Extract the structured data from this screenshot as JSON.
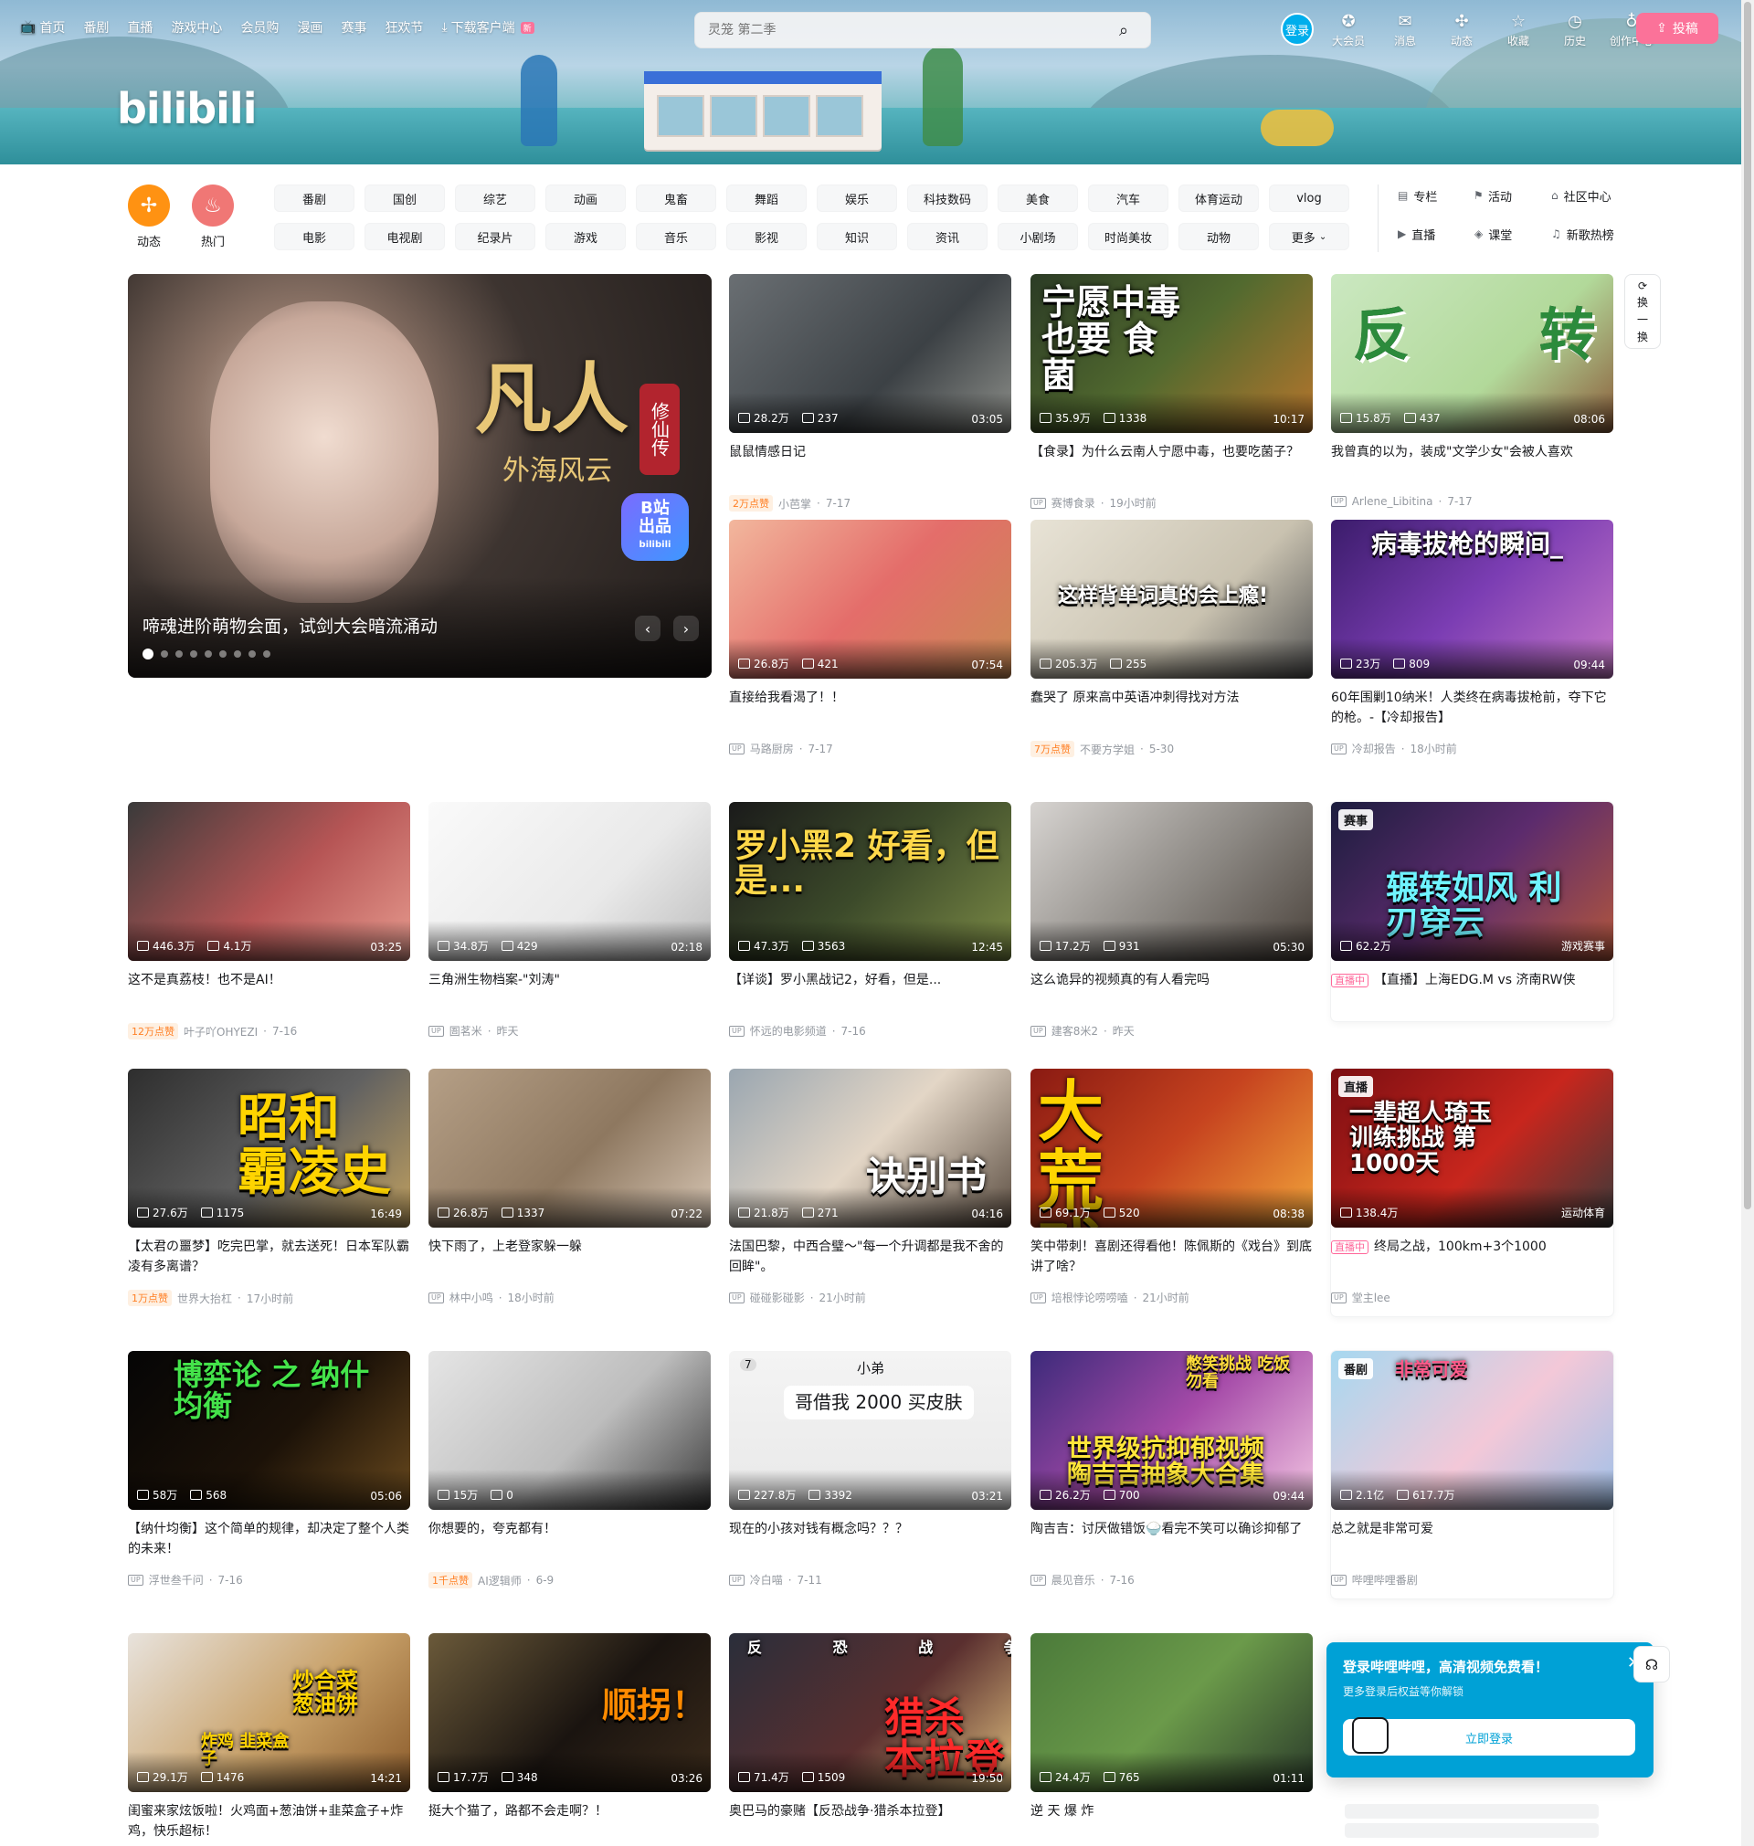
{
  "topnav": [
    {
      "icon": "tv-icon",
      "label": "首页"
    },
    {
      "label": "番剧"
    },
    {
      "label": "直播"
    },
    {
      "label": "游戏中心"
    },
    {
      "label": "会员购"
    },
    {
      "label": "漫画"
    },
    {
      "label": "赛事"
    },
    {
      "label": "狂欢节"
    },
    {
      "icon": "download-icon",
      "label": "下载客户端",
      "badge": "新"
    }
  ],
  "logo": "bilibili",
  "search": {
    "placeholder": "灵笼 第二季"
  },
  "user": {
    "login": "登录",
    "items": [
      {
        "icon": "vip-icon",
        "label": "大会员"
      },
      {
        "icon": "message-icon",
        "label": "消息"
      },
      {
        "icon": "dynamic-icon",
        "label": "动态"
      },
      {
        "icon": "star-icon",
        "label": "收藏"
      },
      {
        "icon": "history-icon",
        "label": "历史"
      },
      {
        "icon": "bulb-icon",
        "label": "创作中心"
      }
    ],
    "upload": "投稿"
  },
  "channels": {
    "big": [
      {
        "label": "动态",
        "color": "#ff9212"
      },
      {
        "label": "热门",
        "color": "#f07775"
      }
    ],
    "row1": [
      "番剧",
      "国创",
      "综艺",
      "动画",
      "鬼畜",
      "舞蹈",
      "娱乐",
      "科技数码",
      "美食",
      "汽车",
      "体育运动",
      "vlog"
    ],
    "row2": [
      "电影",
      "电视剧",
      "纪录片",
      "游戏",
      "音乐",
      "影视",
      "知识",
      "资讯",
      "小剧场",
      "时尚美妆",
      "动物",
      "更多"
    ],
    "side": [
      {
        "icon": "column-icon",
        "label": "专栏"
      },
      {
        "icon": "flag-icon",
        "label": "活动"
      },
      {
        "icon": "community-icon",
        "label": "社区中心"
      },
      {
        "icon": "live-icon",
        "label": "直播"
      },
      {
        "icon": "class-icon",
        "label": "课堂"
      },
      {
        "icon": "music-icon",
        "label": "新歌热榜"
      }
    ]
  },
  "hero": {
    "title": "凡人",
    "subtitle": "外海风云",
    "vertical": "修仙传",
    "badge1": "B站",
    "badge2": "出品",
    "badge3": "bilibili",
    "caption": "啼魂进阶萌物会面，试剑大会暗流涌动"
  },
  "refresh": {
    "label1": "换",
    "label2": "一",
    "label3": "换"
  },
  "videos": [
    {
      "views": "28.2万",
      "danmaku": "237",
      "duration": "03:05",
      "title": "鼠鼠情感日记",
      "like": "2万点赞",
      "up": "小芭掌",
      "date": "7-17"
    },
    {
      "views": "35.9万",
      "danmaku": "1338",
      "duration": "10:17",
      "title": "【食录】为什么云南人宁愿中毒，也要吃菌子？",
      "up": "赛博食录",
      "date": "19小时前",
      "overlay": "宁愿中毒 也要 食菌"
    },
    {
      "views": "15.8万",
      "danmaku": "437",
      "duration": "08:06",
      "title": "我曾真的以为，装成\"文学少女\"会被人喜欢",
      "up": "Arlene_Libitina",
      "date": "7-17",
      "overlay": "反 转"
    },
    {
      "views": "26.8万",
      "danmaku": "421",
      "duration": "07:54",
      "title": "直接给我看渴了！！",
      "up": "马路厨房",
      "date": "7-17"
    },
    {
      "views": "205.3万",
      "danmaku": "255",
      "duration": "",
      "title": "蠢哭了 原来高中英语冲刺得找对方法",
      "like": "7万点赞",
      "up": "不要方学姐",
      "date": "5-30",
      "overlay": "这样背单词真的会上瘾!"
    },
    {
      "views": "23万",
      "danmaku": "809",
      "duration": "09:44",
      "title": "60年围剿10纳米！人类终在病毒拔枪前，夺下它的枪。-【冷却报告】",
      "up": "冷却报告",
      "date": "18小时前",
      "overlay": "病毒拔枪的瞬间_"
    },
    {
      "views": "446.3万",
      "danmaku": "4.1万",
      "duration": "03:25",
      "title": "这不是真荔枝！也不是AI！",
      "like": "12万点赞",
      "up": "叶子吖OHYEZI",
      "date": "7-16"
    },
    {
      "views": "34.8万",
      "danmaku": "429",
      "duration": "02:18",
      "title": "三角洲生物档案-\"刘涛\"",
      "up": "圄茗米",
      "date": "昨天"
    },
    {
      "views": "47.3万",
      "danmaku": "3563",
      "duration": "12:45",
      "title": "【详谈】罗小黑战记2，好看，但是...",
      "up": "怀远的电影频道",
      "date": "7-16",
      "overlay": "罗小黑2 好看，但是..."
    },
    {
      "views": "17.2万",
      "danmaku": "931",
      "duration": "05:30",
      "title": "这么诡异的视频真的有人看完吗",
      "up": "建客8米2",
      "date": "昨天"
    },
    {
      "views": "62.2万",
      "danmaku": "",
      "duration": "游戏赛事",
      "title": "【直播】上海EDG.M vs 济南RW侠",
      "live": "直播中",
      "tag": "赛事",
      "overlay": "辗转如风 利刃穿云"
    },
    {
      "views": "27.6万",
      "danmaku": "1175",
      "duration": "16:49",
      "title": "【太君の噩梦】吃完巴掌，就去送死！日本军队霸凌有多离谱？",
      "like": "1万点赞",
      "up": "世界大抬杠",
      "date": "17小时前",
      "overlay": "昭和 霸凌史"
    },
    {
      "views": "26.8万",
      "danmaku": "1337",
      "duration": "07:22",
      "title": "快下雨了，上老登家躲一躲",
      "up": "林中小鸣",
      "date": "18小时前"
    },
    {
      "views": "21.8万",
      "danmaku": "271",
      "duration": "04:16",
      "title": "法国巴黎，中西合璧～\"每一个升调都是我不舍的回眸\"。",
      "up": "碰碰影碰影",
      "date": "21小时前",
      "overlay": "诀别书"
    },
    {
      "views": "69.1万",
      "danmaku": "520",
      "duration": "08:38",
      "title": "笑中带刺！喜剧还得看他！陈佩斯的《戏台》到底讲了啥？",
      "up": "培根悖论唠唠嗑",
      "date": "21小时前",
      "overlay": "大 荒 戏 诞"
    },
    {
      "views": "138.4万",
      "danmaku": "",
      "duration": "运动体育",
      "title": "终局之战，100km+3个1000",
      "live": "直播中",
      "up": "堂主lee",
      "tag": "直播",
      "overlay": "一辈超人琦玉 训练挑战 第1000天"
    },
    {
      "views": "58万",
      "danmaku": "568",
      "duration": "05:06",
      "title": "【纳什均衡】这个简单的规律，却决定了整个人类的未来！",
      "up": "浮世叁千问",
      "date": "7-16",
      "overlay": "博弈论 之 纳什均衡"
    },
    {
      "views": "15万",
      "danmaku": "0",
      "duration": "",
      "title": "你想要的，夸克都有！",
      "like": "1千点赞",
      "up": "AI逻辑师",
      "date": "6-9"
    },
    {
      "views": "227.8万",
      "danmaku": "3392",
      "duration": "03:21",
      "title": "现在的小孩对钱有概念吗？？？",
      "up": "冷白喵",
      "date": "7-11",
      "overlay": "哥借我 2000 买皮肤",
      "chatname": "小弟",
      "chatnum": "7"
    },
    {
      "views": "26.2万",
      "danmaku": "700",
      "duration": "09:44",
      "title": "陶吉吉：讨厌做错饭🍚看完不笑可以确诊抑郁了",
      "up": "晨见音乐",
      "date": "7-16",
      "overlay": "世界级抗抑郁视频 陶吉吉抽象大合集",
      "overlay2": "憋笑挑战 吃饭勿看"
    },
    {
      "views": "2.1亿",
      "danmaku": "617.7万",
      "duration": "",
      "title": "总之就是非常可爱",
      "up": "哔哩哔哩番剧",
      "tag": "番剧",
      "overlay": "非常可爱"
    },
    {
      "views": "29.1万",
      "danmaku": "1476",
      "duration": "14:21",
      "title": "闺蜜来家炫饭啦！火鸡面+葱油饼+韭菜盒子+炸鸡，快乐超标！",
      "overlay": "炒合菜 葱油饼",
      "overlay2": "炸鸡 韭菜盒子"
    },
    {
      "views": "17.7万",
      "danmaku": "348",
      "duration": "03:26",
      "title": "挺大个猫了，路都不会走啊？！",
      "overlay": "顺拐！"
    },
    {
      "views": "71.4万",
      "danmaku": "1509",
      "duration": "19:50",
      "title": "奥巴马的豪赌【反恐战争·猎杀本拉登】",
      "overlay": "猎杀 本拉登",
      "overlay2": "反 恐 战 争"
    },
    {
      "views": "24.4万",
      "danmaku": "765",
      "duration": "01:11",
      "title": "逆 天 爆 炸"
    }
  ],
  "loginpop": {
    "title": "登录哔哩哔哩，高清视频免费看！",
    "sub": "更多登录后权益等你解锁",
    "button": "立即登录"
  }
}
